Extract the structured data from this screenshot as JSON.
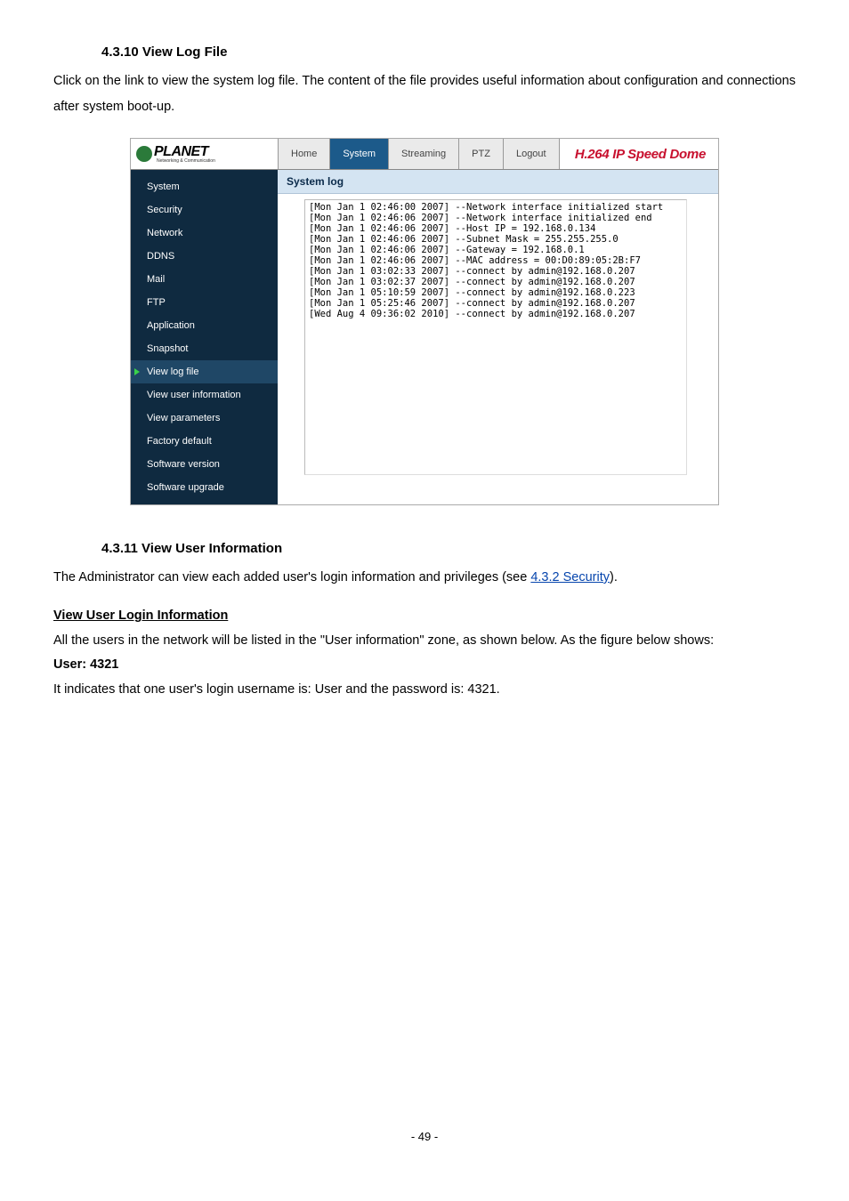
{
  "section1": {
    "heading": "4.3.10 View Log File",
    "para": "Click on the link to view the system log file. The content of the file provides useful information about configuration and connections after system boot-up."
  },
  "screenshot": {
    "logo": {
      "name": "PLANET",
      "sub": "Networking & Communication"
    },
    "tabs": [
      "Home",
      "System",
      "Streaming",
      "PTZ",
      "Logout"
    ],
    "active_tab_index": 1,
    "brand": "H.264 IP Speed Dome",
    "pane_title": "System log",
    "sidebar_items": [
      "System",
      "Security",
      "Network",
      "DDNS",
      "Mail",
      "FTP",
      "Application",
      "Snapshot",
      "View log file",
      "View user information",
      "View parameters",
      "Factory default",
      "Software version",
      "Software upgrade"
    ],
    "selected_sidebar_index": 8,
    "log_lines": [
      "[Mon Jan  1 02:46:00 2007] --Network interface initialized start",
      "[Mon Jan  1 02:46:06 2007] --Network interface initialized end",
      "[Mon Jan  1 02:46:06 2007] --Host IP = 192.168.0.134",
      "[Mon Jan  1 02:46:06 2007] --Subnet Mask = 255.255.255.0",
      "[Mon Jan  1 02:46:06 2007] --Gateway = 192.168.0.1",
      "[Mon Jan  1 02:46:06 2007] --MAC address = 00:D0:89:05:2B:F7",
      "[Mon Jan  1 03:02:33 2007] --connect by admin@192.168.0.207",
      "[Mon Jan  1 03:02:37 2007] --connect by admin@192.168.0.207",
      "[Mon Jan  1 05:10:59 2007] --connect by admin@192.168.0.223",
      "[Mon Jan  1 05:25:46 2007] --connect by admin@192.168.0.207",
      "[Wed Aug  4 09:36:02 2010] --connect by admin@192.168.0.207"
    ]
  },
  "section2": {
    "heading": "4.3.11  View User Information",
    "para_prefix": "The Administrator can view each added user's login information and privileges (see ",
    "link_text": "4.3.2 Security",
    "para_suffix": ").",
    "subheading": "View User Login Information",
    "para2": "All the users in the network will be listed in the \"User information\" zone, as shown below. As the figure below shows:",
    "user_line": "User: 4321",
    "para3": "It indicates that one user's login username is: User and the password is: 4321."
  },
  "footer": {
    "page": "- 49 -"
  }
}
